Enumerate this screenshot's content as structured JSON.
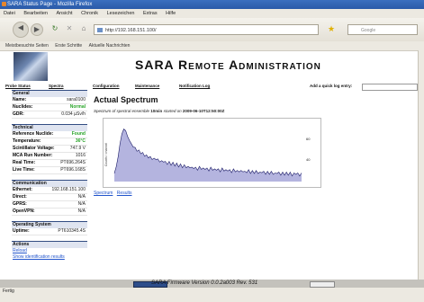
{
  "window": {
    "title": "SARA Status Page - Mozilla Firefox"
  },
  "menu": [
    "Datei",
    "Bearbeiten",
    "Ansicht",
    "Chronik",
    "Lesezeichen",
    "Extras",
    "Hilfe"
  ],
  "navbar": {
    "url": "http://192.168.151.100/",
    "search_placeholder": "Google"
  },
  "bookmarks": [
    "Meistbesuchte Seiten",
    "Erste Schritte",
    "Aktuelle Nachrichten"
  ],
  "site": {
    "title": "SARA Remote Administration"
  },
  "topnav": {
    "items": [
      "Probe Status",
      "Spectra",
      "Configuration",
      "Maintenance",
      "Notification Log"
    ],
    "quick_log_label": "Add a quick log entry:"
  },
  "sidebar": {
    "general": {
      "heading": "General",
      "rows": [
        {
          "k": "Name:",
          "v": "sara0100"
        },
        {
          "k": "Nuclides:",
          "v": "Normal"
        },
        {
          "k": "GDR:",
          "v": "0.034 µSv/h"
        }
      ]
    },
    "technical": {
      "heading": "Technical",
      "rows": [
        {
          "k": "Reference Nuclide:",
          "v": "Found"
        },
        {
          "k": "Temperature:",
          "v": "36°C"
        },
        {
          "k": "Scintillator Voltage:",
          "v": "747.9 V"
        },
        {
          "k": "MCA Run Number:",
          "v": "1016"
        },
        {
          "k": "Real Time:",
          "v": "PT696.264S"
        },
        {
          "k": "Live Time:",
          "v": "PT696.168S"
        }
      ]
    },
    "communication": {
      "heading": "Communication",
      "rows": [
        {
          "k": "Ethernet:",
          "v": "192.168.151.100"
        },
        {
          "k": "Direct:",
          "v": "N/A"
        },
        {
          "k": "GPRS:",
          "v": "N/A"
        },
        {
          "k": "OpenVPN:",
          "v": "N/A"
        }
      ]
    },
    "os": {
      "heading": "Operating System",
      "rows": [
        {
          "k": "Uptime:",
          "v": "PT610345.4S"
        }
      ]
    },
    "actions": {
      "heading": "Actions",
      "links": [
        "Reload",
        "Show identification results"
      ]
    }
  },
  "main": {
    "heading": "Actual Spectrum",
    "subtitle_prefix": "Spectrum of spectral ensemble",
    "subtitle_bold1": "10min",
    "subtitle_mid": "started on",
    "subtitle_bold2": "2009-06-10T12:50:00Z",
    "links": [
      "Spectrum",
      "Results"
    ]
  },
  "chart_data": {
    "type": "line",
    "title": "",
    "xlabel": "",
    "ylabel": "Counts / channel",
    "ytick_labels": [
      "60",
      "40"
    ],
    "series_color": "#1a1a66",
    "fill_color": "#5858b8",
    "y": [
      10,
      18,
      30,
      46,
      58,
      64,
      62,
      55,
      50,
      46,
      42,
      40,
      38,
      37,
      35,
      34,
      32,
      31,
      30,
      29,
      28,
      27,
      28,
      26,
      25,
      24,
      25,
      23,
      22,
      23,
      21,
      22,
      20,
      21,
      19,
      20,
      18,
      19,
      18,
      17,
      18,
      16,
      17,
      16,
      15,
      17,
      16,
      15,
      16,
      15,
      14,
      16,
      15,
      14,
      15,
      14,
      13,
      15,
      14,
      13,
      14,
      13,
      12,
      14,
      13,
      12,
      13,
      12,
      13,
      11,
      12,
      13,
      11,
      12,
      11,
      12,
      11,
      10,
      12,
      11,
      10,
      11,
      10,
      11,
      10,
      9,
      11,
      10,
      9,
      10,
      9,
      10,
      9,
      10,
      8,
      9,
      10,
      9,
      8,
      9
    ]
  },
  "footer": {
    "firmware": "SARA Firmware Version 0.0.2a003 Rev. 531"
  },
  "status": {
    "text": "Fertig"
  }
}
